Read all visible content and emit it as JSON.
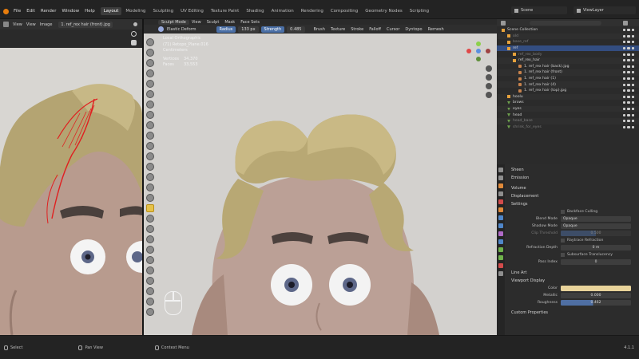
{
  "topbar": {
    "menus": [
      "File",
      "Edit",
      "Render",
      "Window",
      "Help"
    ],
    "workspaces": [
      "Layout",
      "Modeling",
      "Sculpting",
      "UV Editing",
      "Texture Paint",
      "Shading",
      "Animation",
      "Rendering",
      "Compositing",
      "Geometry Nodes",
      "Scripting"
    ],
    "active_workspace": "Layout",
    "scene_label": "Scene",
    "view_layer_label": "ViewLayer"
  },
  "image_editor": {
    "header": [
      "View",
      "View",
      "Image"
    ],
    "image_name": "1. ref_rex hair (front).jpg"
  },
  "viewport": {
    "tool_name": "Elastic Deform",
    "mode": "Sculpt Mode",
    "menus": [
      "View",
      "Sculpt",
      "Mask",
      "Face Sets"
    ],
    "radius_label": "Radius",
    "radius_value": "133 px",
    "strength_label": "Strength",
    "strength_value": "0.485",
    "header2": [
      "Brush",
      "Texture",
      "Stroke",
      "Falloff",
      "Cursor"
    ],
    "dyntopo": "Dyntopo",
    "remesh": "Remesh",
    "info": {
      "view": "Local Orthographic",
      "object": "(71) Retopo_Plane.016",
      "unit": "Centimeters",
      "vertices_label": "Vertices",
      "vertices_value": "34,370",
      "faces_label": "Faces",
      "faces_value": "33,553"
    }
  },
  "outliner": {
    "header": "Scene Collection",
    "rows": [
      {
        "label": "Scene Collection",
        "level": 0,
        "icon": "box"
      },
      {
        "label": "old",
        "level": 1,
        "icon": "box",
        "dim": true
      },
      {
        "label": "base_ref",
        "level": 1,
        "icon": "box",
        "dim": true
      },
      {
        "label": "ref",
        "level": 1,
        "icon": "box"
      },
      {
        "label": "ref_rex_body",
        "level": 2,
        "icon": "box",
        "dim": true
      },
      {
        "label": "ref_rex_hair",
        "level": 2,
        "icon": "box"
      },
      {
        "label": "1. ref_rex hair (back).jpg",
        "level": 3,
        "icon": "img"
      },
      {
        "label": "1. ref_rex hair (front)",
        "level": 3,
        "icon": "img"
      },
      {
        "label": "1. ref_rex hair (1)",
        "level": 3,
        "icon": "img"
      },
      {
        "label": "1. ref_rex hair (4)",
        "level": 3,
        "icon": "img"
      },
      {
        "label": "1. ref_rex hair (top).jpg",
        "level": 3,
        "icon": "img"
      },
      {
        "label": "hoolu",
        "level": 1,
        "icon": "box"
      },
      {
        "label": "brows",
        "level": 1,
        "icon": "tri"
      },
      {
        "label": "eyes",
        "level": 1,
        "icon": "tri"
      },
      {
        "label": "head",
        "level": 1,
        "icon": "tri"
      },
      {
        "label": "head_base",
        "level": 1,
        "icon": "tri",
        "dim": true
      },
      {
        "label": "shrink_for_eyes",
        "level": 1,
        "icon": "tri",
        "dim": true
      }
    ]
  },
  "properties": {
    "sections": {
      "sheen": "Sheen",
      "emission": "Emission",
      "volume": "Volume",
      "displacement": "Displacement",
      "settings": "Settings",
      "line_art": "Line Art",
      "viewport_display": "Viewport Display",
      "custom_props": "Custom Properties"
    },
    "backface_culling": "Backface Culling",
    "blend_mode_label": "Blend Mode",
    "blend_mode_value": "Opaque",
    "shadow_mode_label": "Shadow Mode",
    "shadow_mode_value": "Opaque",
    "clip_threshold_label": "Clip Threshold",
    "clip_threshold_value": "0.500",
    "screen_space_refraction": "Raytrace Refraction",
    "refraction_depth_label": "Refraction Depth",
    "refraction_depth_value": "0 m",
    "subsurface_translucency": "Subsurface Translucency",
    "pass_index_label": "Pass Index",
    "pass_index_value": "0",
    "color_label": "Color",
    "color_hex": "#e8d39a",
    "metallic_label": "Metallic",
    "metallic_value": "0.000",
    "roughness_label": "Roughness",
    "roughness_value": "0.462"
  },
  "status": {
    "select": "Select",
    "pan_view": "Pan View",
    "context_menu": "Context Menu",
    "version": "4.1.1"
  }
}
